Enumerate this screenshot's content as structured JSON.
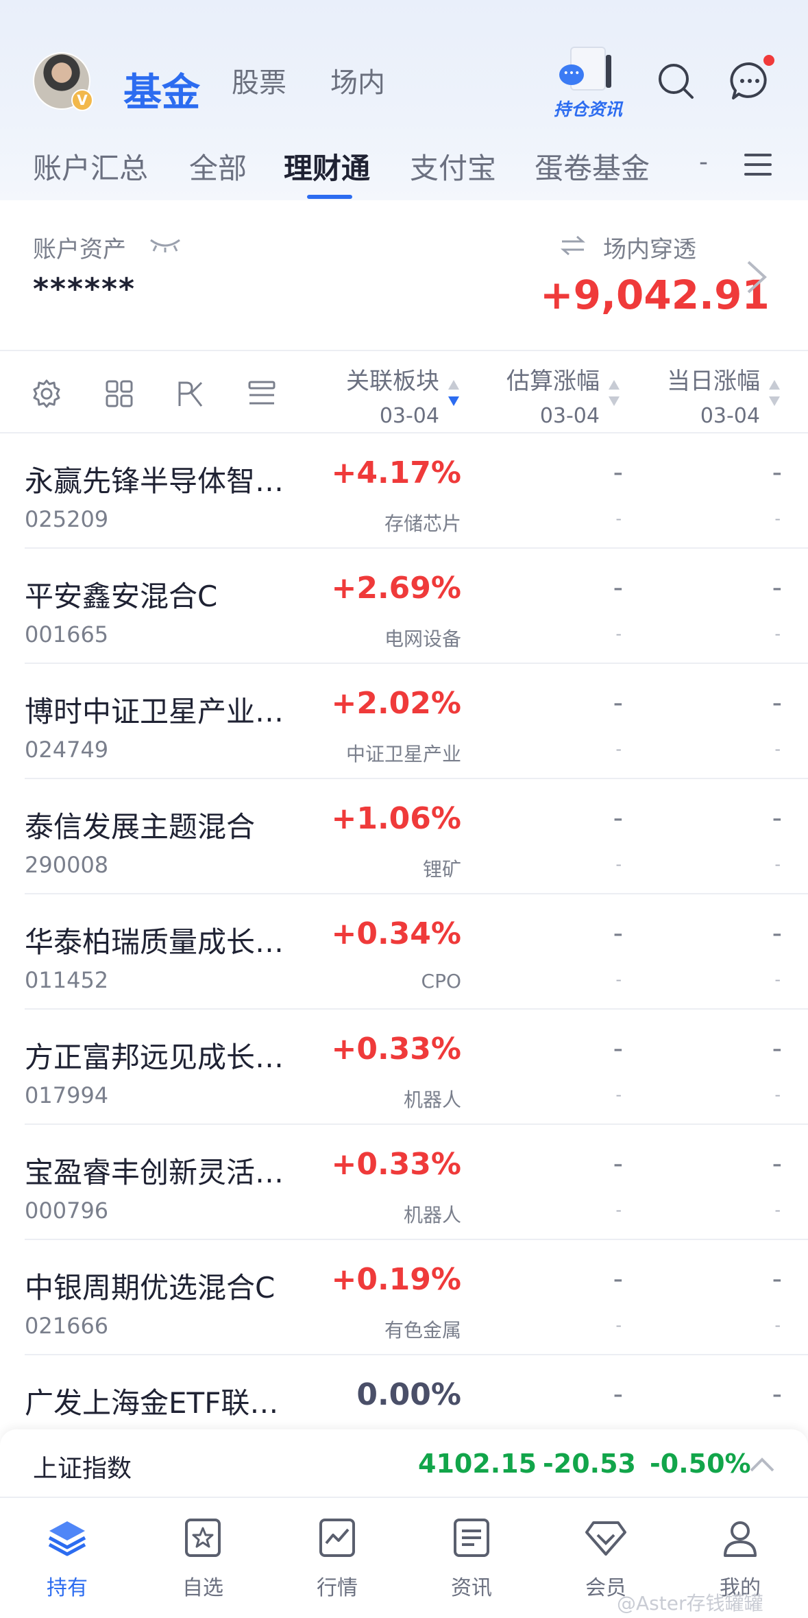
{
  "header": {
    "tabs": [
      "基金",
      "股票",
      "场内"
    ],
    "hold_news_label": "持仓资讯"
  },
  "subtabs": {
    "items": [
      "账户汇总",
      "全部",
      "理财通",
      "支付宝",
      "蛋卷基金"
    ],
    "active": "理财通",
    "more": "-"
  },
  "asset": {
    "label": "账户资产",
    "value": "******",
    "penetration_label": "场内穿透",
    "penetration_value": "+9,042.91"
  },
  "columns": [
    {
      "title": "关联板块",
      "date": "03-04"
    },
    {
      "title": "估算涨幅",
      "date": "03-04"
    },
    {
      "title": "当日涨幅",
      "date": "03-04"
    }
  ],
  "funds": [
    {
      "name": "永赢先锋半导体智…",
      "code": "025209",
      "change": "+4.17%",
      "sector": "存储芯片",
      "est": "-",
      "est_sub": "-",
      "day": "-",
      "day_sub": "-"
    },
    {
      "name": "平安鑫安混合C",
      "code": "001665",
      "change": "+2.69%",
      "sector": "电网设备",
      "est": "-",
      "est_sub": "-",
      "day": "-",
      "day_sub": "-"
    },
    {
      "name": "博时中证卫星产业…",
      "code": "024749",
      "change": "+2.02%",
      "sector": "中证卫星产业",
      "est": "-",
      "est_sub": "-",
      "day": "-",
      "day_sub": "-"
    },
    {
      "name": "泰信发展主题混合",
      "code": "290008",
      "change": "+1.06%",
      "sector": "锂矿",
      "est": "-",
      "est_sub": "-",
      "day": "-",
      "day_sub": "-"
    },
    {
      "name": "华泰柏瑞质量成长…",
      "code": "011452",
      "change": "+0.34%",
      "sector": "CPO",
      "est": "-",
      "est_sub": "-",
      "day": "-",
      "day_sub": "-"
    },
    {
      "name": "方正富邦远见成长…",
      "code": "017994",
      "change": "+0.33%",
      "sector": "机器人",
      "est": "-",
      "est_sub": "-",
      "day": "-",
      "day_sub": "-"
    },
    {
      "name": "宝盈睿丰创新灵活…",
      "code": "000796",
      "change": "+0.33%",
      "sector": "机器人",
      "est": "-",
      "est_sub": "-",
      "day": "-",
      "day_sub": "-"
    },
    {
      "name": "中银周期优选混合C",
      "code": "021666",
      "change": "+0.19%",
      "sector": "有色金属",
      "est": "-",
      "est_sub": "-",
      "day": "-",
      "day_sub": "-"
    },
    {
      "name": "广发上海金ETF联…",
      "code": "",
      "change": "0.00%",
      "sector": "",
      "est": "-",
      "est_sub": "",
      "day": "-",
      "day_sub": ""
    }
  ],
  "index_bar": {
    "name": "上证指数",
    "value": "4102.15",
    "change": "-20.53",
    "percent": "-0.50%"
  },
  "bottom_nav": [
    {
      "label": "持有",
      "icon": "layers-icon"
    },
    {
      "label": "自选",
      "icon": "star-box-icon"
    },
    {
      "label": "行情",
      "icon": "chart-icon"
    },
    {
      "label": "资讯",
      "icon": "news-icon"
    },
    {
      "label": "会员",
      "icon": "diamond-icon"
    },
    {
      "label": "我的",
      "icon": "user-icon"
    }
  ],
  "watermark": "@Aster存钱罐罐",
  "colors": {
    "accent": "#2c6cf0",
    "up": "#ef3a3a",
    "down": "#12a54a"
  }
}
